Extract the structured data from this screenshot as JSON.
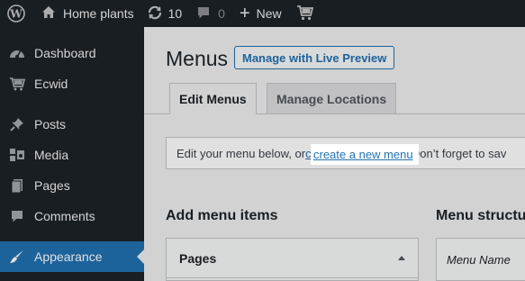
{
  "admin_bar": {
    "site_name": "Home plants",
    "updates_count": "10",
    "comments_count": "0",
    "new_label": "New"
  },
  "sidebar": {
    "items": [
      {
        "label": "Dashboard",
        "icon": "dashboard-icon"
      },
      {
        "label": "Ecwid",
        "icon": "ecwid-icon"
      },
      {
        "label": "Posts",
        "icon": "pin-icon"
      },
      {
        "label": "Media",
        "icon": "media-icon"
      },
      {
        "label": "Pages",
        "icon": "pages-icon"
      },
      {
        "label": "Comments",
        "icon": "comments-icon"
      },
      {
        "label": "Appearance",
        "icon": "brush-icon",
        "current": true
      }
    ]
  },
  "main": {
    "title": "Menus",
    "live_preview_label": "Manage with Live Preview",
    "tabs": [
      {
        "label": "Edit Menus",
        "active": true
      },
      {
        "label": "Manage Locations",
        "active": false
      }
    ],
    "notice": {
      "before": "Edit your menu below, or ",
      "link": "create a new menu",
      "after": ". Don’t forget to sav"
    },
    "add_items_title": "Add menu items",
    "structure_title": "Menu structu",
    "pages_box_label": "Pages",
    "menu_name_label": "Menu Name"
  },
  "colors": {
    "admin_bar_bg": "#1d2327",
    "accent": "#2271b1",
    "page_bg": "#f0f0f1"
  }
}
